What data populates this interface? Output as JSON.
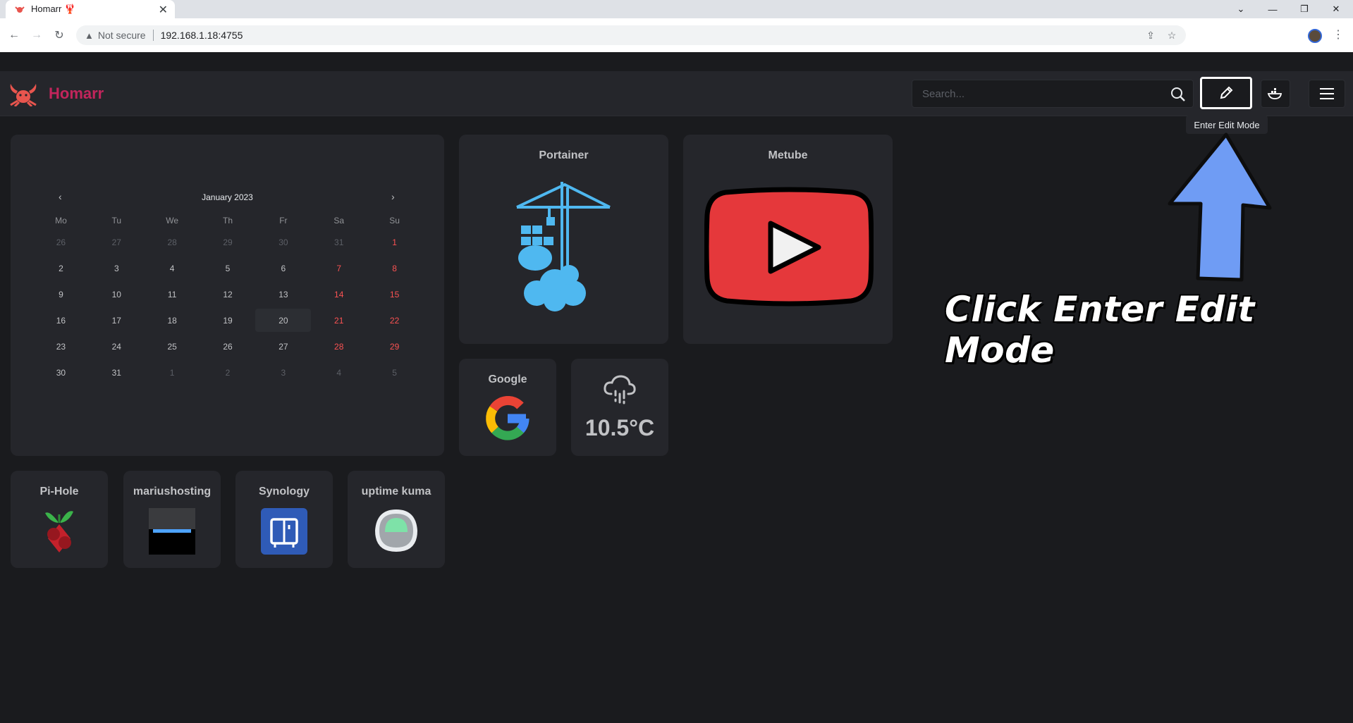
{
  "browser": {
    "tab_title": "Homarr 🦞",
    "security_label": "Not secure",
    "url": "192.168.1.18:4755"
  },
  "header": {
    "brand": "Homarr",
    "search_placeholder": "Search...",
    "tooltip": "Enter Edit Mode"
  },
  "calendar": {
    "month_label": "January 2023",
    "prev": "‹",
    "next": "›",
    "weekdays": [
      "Mo",
      "Tu",
      "We",
      "Th",
      "Fr",
      "Sa",
      "Su"
    ],
    "weeks": [
      [
        "26",
        "27",
        "28",
        "29",
        "30",
        "31",
        "1"
      ],
      [
        "2",
        "3",
        "4",
        "5",
        "6",
        "7",
        "8"
      ],
      [
        "9",
        "10",
        "11",
        "12",
        "13",
        "14",
        "15"
      ],
      [
        "16",
        "17",
        "18",
        "19",
        "20",
        "21",
        "22"
      ],
      [
        "23",
        "24",
        "25",
        "26",
        "27",
        "28",
        "29"
      ],
      [
        "30",
        "31",
        "1",
        "2",
        "3",
        "4",
        "5"
      ]
    ]
  },
  "tiles": {
    "portainer": "Portainer",
    "metube": "Metube",
    "google": "Google",
    "weather_temp": "10.5°C",
    "pihole": "Pi-Hole",
    "mariushosting": "mariushosting",
    "synology": "Synology",
    "uptime_kuma": "uptime kuma"
  },
  "annotation": {
    "text": "Click Enter Edit Mode"
  }
}
